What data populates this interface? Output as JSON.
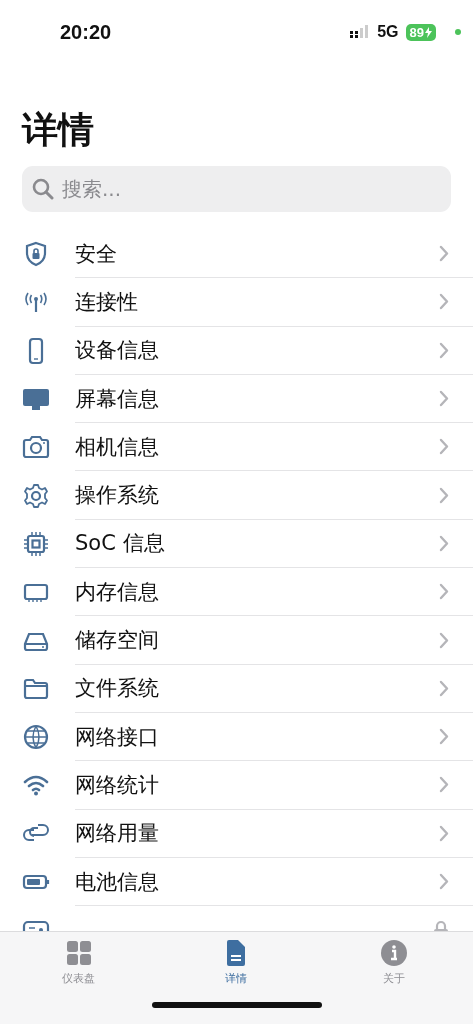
{
  "status_bar": {
    "time": "20:20",
    "network": "5G",
    "battery": "89",
    "charging": true,
    "privacy_dot": true
  },
  "title": "详情",
  "search": {
    "placeholder": "搜索..."
  },
  "items": [
    {
      "label": "安全",
      "locked": false
    },
    {
      "label": "连接性",
      "locked": false
    },
    {
      "label": "设备信息",
      "locked": false
    },
    {
      "label": "屏幕信息",
      "locked": false
    },
    {
      "label": "相机信息",
      "locked": false
    },
    {
      "label": "操作系统",
      "locked": false
    },
    {
      "label": "SoC 信息",
      "locked": false
    },
    {
      "label": "内存信息",
      "locked": false
    },
    {
      "label": "储存空间",
      "locked": false
    },
    {
      "label": "文件系统",
      "locked": false
    },
    {
      "label": "网络接口",
      "locked": false
    },
    {
      "label": "网络统计",
      "locked": false
    },
    {
      "label": "网络用量",
      "locked": false
    },
    {
      "label": "电池信息",
      "locked": false
    },
    {
      "locked": true
    }
  ],
  "tabs": [
    {
      "label": "仪表盘",
      "selected": false
    },
    {
      "label": "详情",
      "selected": true
    },
    {
      "label": "关于",
      "selected": false
    }
  ]
}
